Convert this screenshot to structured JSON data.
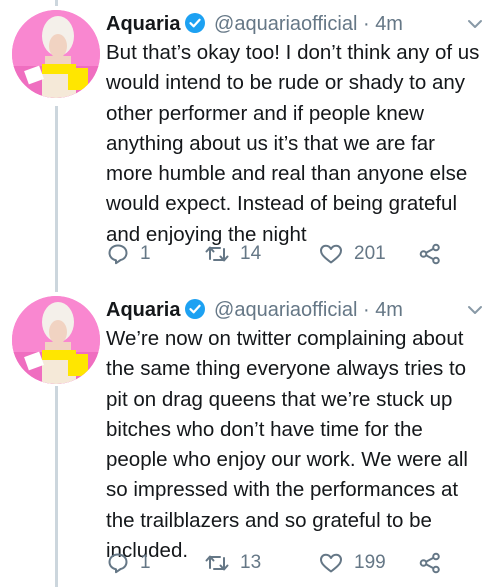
{
  "tweets": [
    {
      "author_name": "Aquaria",
      "author_handle": "@aquariaofficial",
      "separator": "·",
      "time": "4m",
      "text": "But that’s okay too! I don’t think any of us would intend to be rude or shady to any other performer and if people knew anything about us it’s that we are far more humble and real than anyone else would expect. Instead of being grateful and enjoying the night",
      "reply_count": "1",
      "retweet_count": "14",
      "like_count": "201"
    },
    {
      "author_name": "Aquaria",
      "author_handle": "@aquariaofficial",
      "separator": "·",
      "time": "4m",
      "text": "We’re now on twitter complaining about the same thing everyone always tries to pit on drag queens that we’re stuck up bitches who don’t have time for the people who enjoy our work. We were all so impressed with the performances at the trailblazers and so grateful to be included.",
      "reply_count": "1",
      "retweet_count": "13",
      "like_count": "199"
    }
  ],
  "colors": {
    "verified": "#1da1f2",
    "muted": "#657786",
    "text": "#14171a",
    "thread_line": "#ccd6dd"
  },
  "icons": [
    "verified-badge-icon",
    "chevron-down-icon",
    "reply-icon",
    "retweet-icon",
    "like-icon",
    "share-icon"
  ]
}
